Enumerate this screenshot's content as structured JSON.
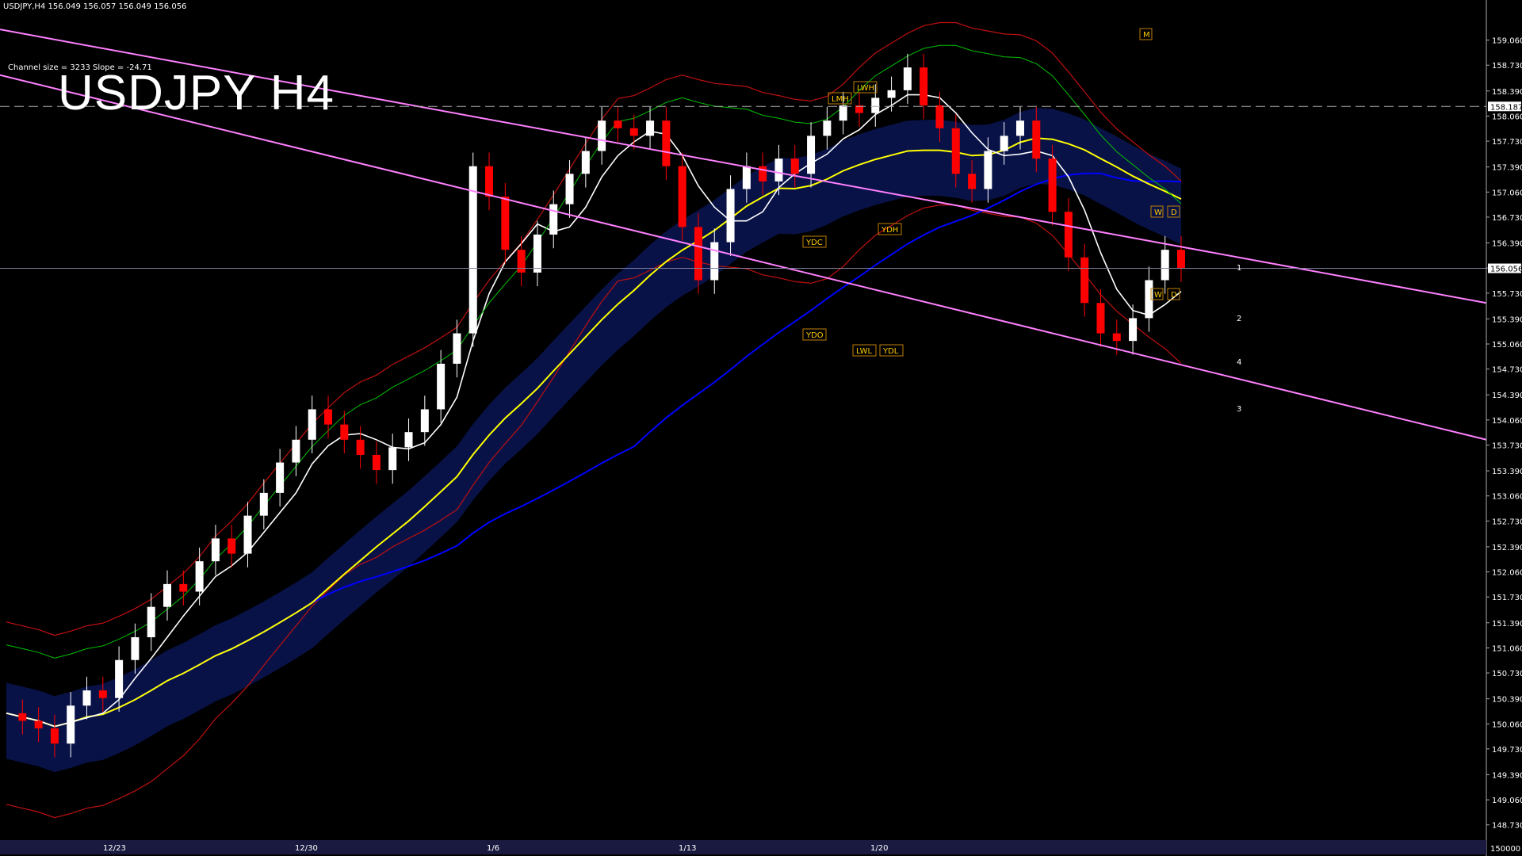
{
  "header": {
    "symbol_line": "USDJPY,H4  156.049 156.057 156.049 156.056",
    "channel_info": "Channel size = 3233 Slope = -24.71",
    "big_title": "USDJPY H4"
  },
  "chart_data": {
    "type": "line",
    "symbol": "USDJPY",
    "timeframe": "H4",
    "ylim": [
      148.55,
      159.4
    ],
    "y_ticks": [
      "159.060",
      "158.730",
      "158.390",
      "158.060",
      "157.730",
      "157.390",
      "157.060",
      "156.730",
      "156.390",
      "156.060",
      "155.730",
      "155.390",
      "155.060",
      "154.730",
      "154.390",
      "154.060",
      "153.730",
      "153.390",
      "153.060",
      "152.730",
      "152.390",
      "152.060",
      "151.730",
      "151.390",
      "151.060",
      "150.730",
      "150.390",
      "150.060",
      "149.730",
      "149.390",
      "149.060",
      "148.730"
    ],
    "current_price_label": "156.056",
    "current_price": 156.056,
    "dashed_level_label": "158.187",
    "dashed_level": 158.187,
    "bottom_axis_label": "150000",
    "x_date_labels": [
      "12/23",
      "12/30",
      "1/6",
      "1/13",
      "1/20"
    ],
    "level_tags": [
      "M",
      "LMH",
      "LWH",
      "YDC",
      "YDH",
      "YDO",
      "LWL",
      "YDL",
      "W",
      "D",
      "W",
      "D"
    ],
    "projection_labels": [
      "1",
      "2",
      "4",
      "3"
    ],
    "close_series": [
      150.2,
      150.1,
      150.0,
      149.8,
      150.3,
      150.5,
      150.4,
      150.9,
      151.2,
      151.6,
      151.9,
      151.8,
      152.2,
      152.5,
      152.3,
      152.8,
      153.1,
      153.5,
      153.8,
      154.2,
      154.0,
      153.8,
      153.6,
      153.4,
      153.7,
      153.9,
      154.2,
      154.8,
      155.2,
      157.4,
      157.0,
      156.3,
      156.0,
      156.5,
      156.9,
      157.3,
      157.6,
      158.0,
      157.9,
      157.8,
      158.0,
      157.4,
      156.6,
      155.9,
      156.4,
      157.1,
      157.4,
      157.2,
      157.5,
      157.3,
      157.8,
      158.0,
      158.2,
      158.1,
      158.3,
      158.4,
      158.7,
      158.2,
      157.9,
      157.3,
      157.1,
      157.6,
      157.8,
      158.0,
      157.5,
      156.8,
      156.2,
      155.6,
      155.2,
      155.1,
      155.4,
      155.9,
      156.3,
      156.056
    ],
    "colors": {
      "background": "#000000",
      "bull_candle": "#ffffff",
      "bear_candle": "#ff0000",
      "channel": "#ff80ff",
      "ma_blue": "#0000ff",
      "ma_yellow": "#ffff00",
      "ma_white": "#ffffff",
      "green_osc": "#00c000",
      "cloud_blue": "#1e3fff",
      "cloud_red": "#ff2020"
    }
  }
}
